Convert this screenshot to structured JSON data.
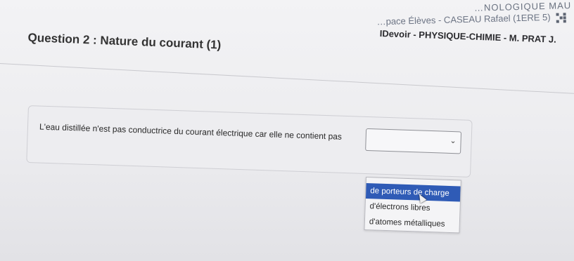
{
  "header": {
    "school": "…NOLOGIQUE MAU",
    "user": "…pace Élèves - CASEAU Rafael (1ERE 5)",
    "devoir": "IDevoir - PHYSIQUE-CHIMIE - M. PRAT J."
  },
  "question": {
    "title": "Question 2 : Nature du courant (1)",
    "text": "L'eau distillée n'est pas conductrice du courant électrique car elle ne contient pas",
    "select_value": ""
  },
  "dropdown": {
    "options": [
      "de porteurs de charge",
      "d'électrons libres",
      "d'atomes métalliques"
    ],
    "highlighted_index": 0
  },
  "icons": [
    "chevron-down-icon",
    "qr-icon",
    "cursor-icon"
  ],
  "colors": {
    "highlight": "#2f5bb6",
    "background": "#ececef"
  }
}
